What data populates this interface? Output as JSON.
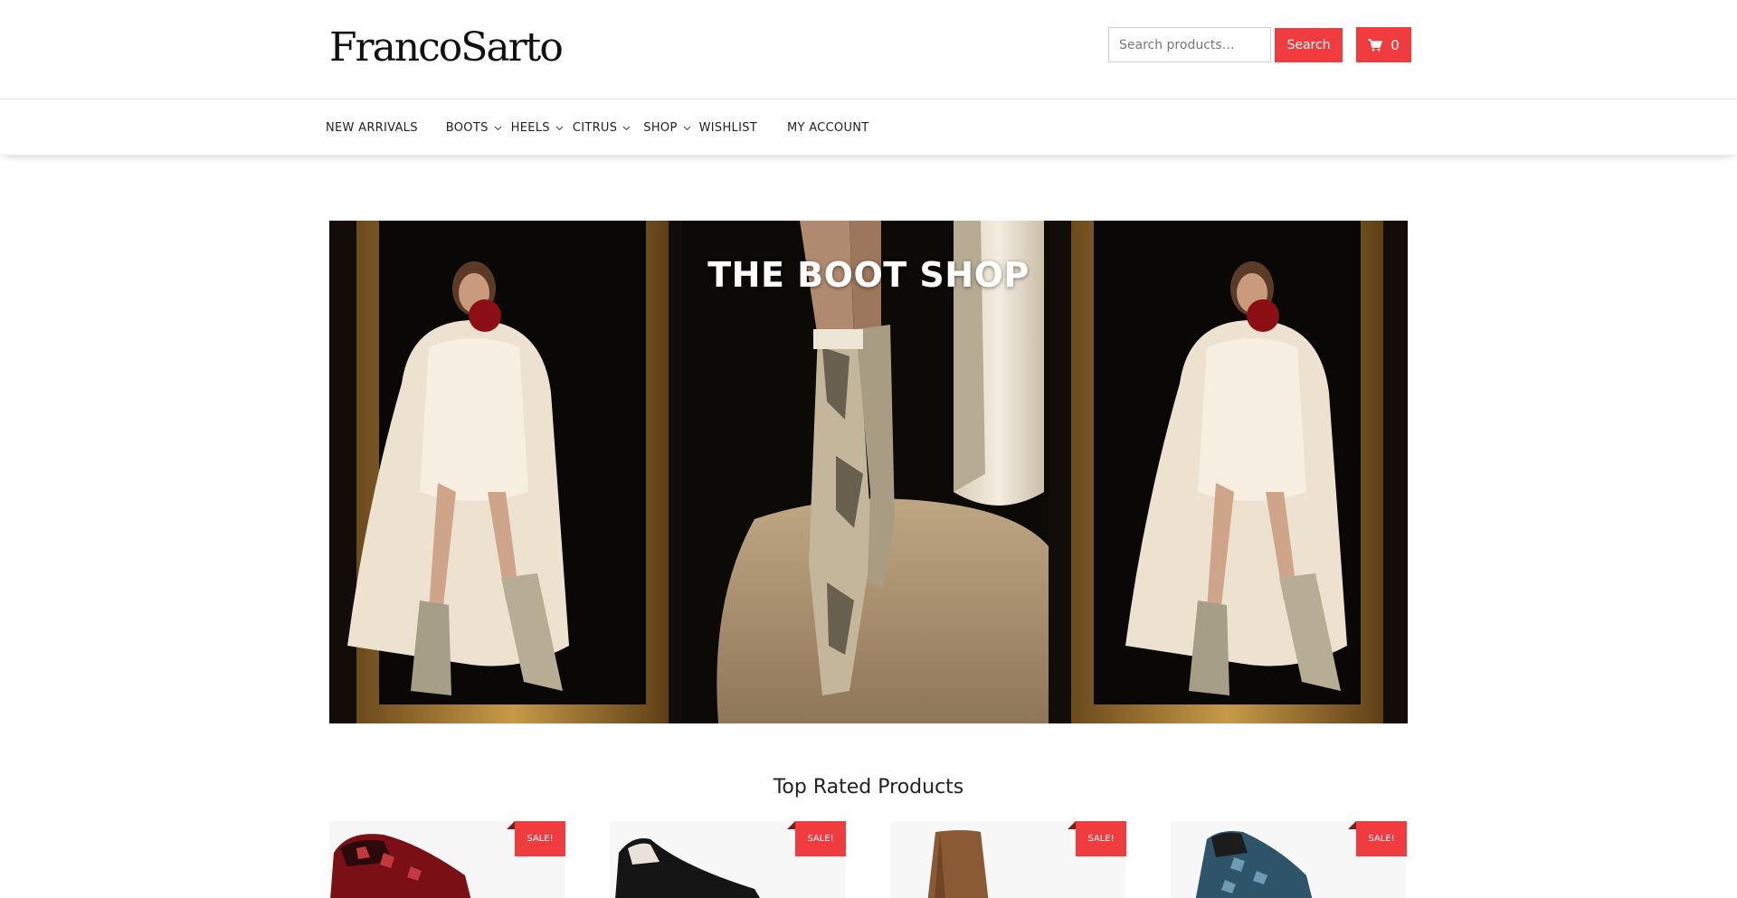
{
  "brand": {
    "logo_text": "FrancoSarto"
  },
  "search": {
    "placeholder": "Search products…",
    "button_label": "Search"
  },
  "cart": {
    "count": "0",
    "icon": "cart-icon"
  },
  "nav": {
    "items": [
      {
        "label": "NEW ARRIVALS",
        "has_dropdown": false
      },
      {
        "label": "BOOTS",
        "has_dropdown": true
      },
      {
        "label": "HEELS",
        "has_dropdown": true
      },
      {
        "label": "CITRUS",
        "has_dropdown": true
      },
      {
        "label": "SHOP",
        "has_dropdown": true
      },
      {
        "label": "WISHLIST",
        "has_dropdown": false
      },
      {
        "label": "MY ACCOUNT",
        "has_dropdown": false
      }
    ]
  },
  "hero": {
    "title": "THE BOOT SHOP"
  },
  "section": {
    "title": "Top Rated Products"
  },
  "products": [
    {
      "badge": "SALE!",
      "description": "red snakeskin loafer"
    },
    {
      "badge": "SALE!",
      "description": "black pointed flat"
    },
    {
      "badge": "SALE!",
      "description": "brown ankle bootie"
    },
    {
      "badge": "SALE!",
      "description": "blue snakeskin slip-on sneaker"
    }
  ],
  "colors": {
    "accent": "#f03b3f",
    "text": "#222222",
    "border": "#e2e2e2"
  }
}
